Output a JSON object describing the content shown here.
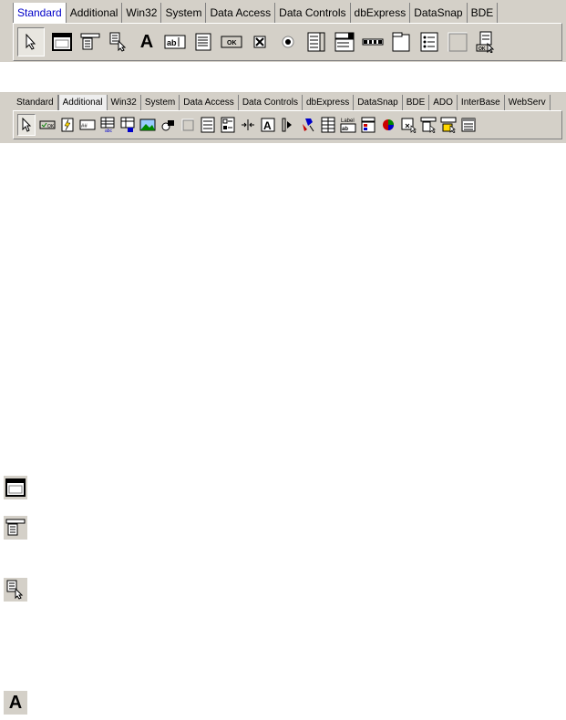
{
  "palette1": {
    "tabs": [
      "Standard",
      "Additional",
      "Win32",
      "System",
      "Data Access",
      "Data Controls",
      "dbExpress",
      "DataSnap",
      "BDE"
    ],
    "active_tab": "Standard",
    "tools": [
      "pointer-icon",
      "frame-icon",
      "main-menu-icon",
      "popup-menu-icon",
      "label-icon",
      "edit-icon",
      "memo-icon",
      "button-icon",
      "checkbox-icon",
      "radio-button-icon",
      "listbox-icon",
      "combobox-icon",
      "scrollbar-icon",
      "groupbox-icon",
      "radio-group-icon",
      "panel-icon",
      "action-list-icon"
    ]
  },
  "palette2": {
    "tabs": [
      "Standard",
      "Additional",
      "Win32",
      "System",
      "Data Access",
      "Data Controls",
      "dbExpress",
      "DataSnap",
      "BDE",
      "ADO",
      "InterBase",
      "WebServ"
    ],
    "active_tab": "Additional",
    "tools": [
      "pointer-icon",
      "bitbtn-icon",
      "speedbutton-icon",
      "maskedit-icon",
      "stringgrid-icon",
      "drawgrid-icon",
      "image-icon",
      "shape-icon",
      "bevel-icon",
      "scrollbox-icon",
      "checklistbox-icon",
      "splitter-icon",
      "statictext-icon",
      "controlbar-icon",
      "applicationevents-icon",
      "valuelisteditor-icon",
      "labelededit-icon",
      "colorbox-icon",
      "chart-icon",
      "actionmanager-icon",
      "actionmainmenubar-icon",
      "actiontoolbar-icon",
      "customizedlg-icon"
    ]
  },
  "label_icon_glyph": "A",
  "labeled_edit_text": "Label",
  "colors": {
    "face": "#d4d0c8",
    "highlight": "#ffffff",
    "shadow": "#808080",
    "active_tab_text": "#0000c8"
  },
  "side_icons": [
    "frame-icon",
    "main-menu-icon",
    "popup-menu-icon",
    "label-icon"
  ]
}
